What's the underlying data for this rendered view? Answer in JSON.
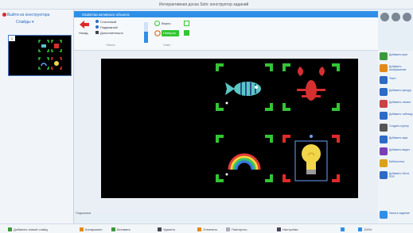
{
  "window": {
    "title": "Интерактивная доска Solo: конструктор заданий"
  },
  "left_panel": {
    "back_label": "Выйти из конструктора",
    "slides_label": "Слайды",
    "slide_number": "1"
  },
  "ribbon": {
    "tab_title": "Свойства активного объекта",
    "move_label": "Назад",
    "options": [
      "Статичный",
      "Подвижный",
      "Дополнительно"
    ],
    "group_object": "Объект",
    "toggles": [
      "Верно",
      "Неверно"
    ],
    "group_answer": "Ответ"
  },
  "right_tools": [
    {
      "label": "Добавить фон",
      "color": "#3a9a3a",
      "icon": "image-icon"
    },
    {
      "label": "Добавить изображение",
      "color": "#e08a1a",
      "icon": "picture-icon"
    },
    {
      "label": "Текст",
      "color": "#2d6bc4",
      "icon": "text-icon"
    },
    {
      "label": "Добавить фигуру",
      "color": "#2d6bc4",
      "icon": "shape-icon"
    },
    {
      "label": "Добавить линию",
      "color": "#c94444",
      "icon": "line-icon"
    },
    {
      "label": "Добавить таблицу",
      "color": "#2d6bc4",
      "icon": "table-icon"
    },
    {
      "label": "Создать группу",
      "color": "#555555",
      "icon": "group-icon"
    },
    {
      "label": "Добавить звук",
      "color": "#2d6bc4",
      "icon": "sound-icon"
    },
    {
      "label": "Добавить видео",
      "color": "#7a3fb5",
      "icon": "video-icon"
    },
    {
      "label": "Библиотека",
      "color": "#d9a21a",
      "icon": "library-icon"
    },
    {
      "label": "Добавить Word, PDF",
      "color": "#2d6bc4",
      "icon": "document-icon"
    }
  ],
  "preview_label": "Начать задание",
  "stage_hint": "Подсказка",
  "status": {
    "add_slide": "Добавить новый слайд",
    "copy": "Копировать",
    "paste": "Вставить",
    "delete": "Удалить",
    "text": "Текст",
    "undo": "Отменить",
    "redo": "Повторить",
    "settings": "Настройки",
    "zoom": "100%"
  },
  "colors": {
    "accent": "#2f8fe6",
    "frame_green": "#33c633",
    "frame_red": "#e02a2a"
  }
}
